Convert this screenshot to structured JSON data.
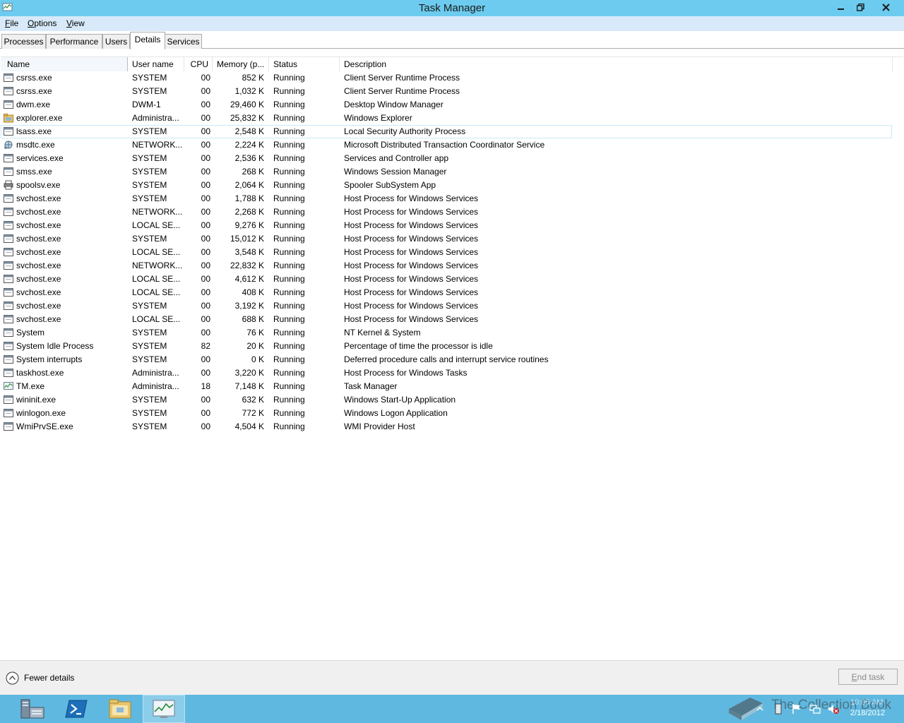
{
  "window": {
    "title": "Task Manager"
  },
  "menu": {
    "file": "File",
    "file_key": "F",
    "file_rest": "ile",
    "options_key": "O",
    "options_rest": "ptions",
    "view_key": "V",
    "view_rest": "iew"
  },
  "tabs": [
    {
      "label": "Processes"
    },
    {
      "label": "Performance"
    },
    {
      "label": "Users"
    },
    {
      "label": "Details",
      "active": true
    },
    {
      "label": "Services"
    }
  ],
  "columns": {
    "name": "Name",
    "user": "User name",
    "cpu": "CPU",
    "memory": "Memory (p...",
    "status": "Status",
    "description": "Description"
  },
  "processes": [
    {
      "name": "csrss.exe",
      "user": "SYSTEM",
      "cpu": "00",
      "memory": "852 K",
      "status": "Running",
      "description": "Client Server Runtime Process",
      "icon": "window-icon"
    },
    {
      "name": "csrss.exe",
      "user": "SYSTEM",
      "cpu": "00",
      "memory": "1,032 K",
      "status": "Running",
      "description": "Client Server Runtime Process",
      "icon": "window-icon"
    },
    {
      "name": "dwm.exe",
      "user": "DWM-1",
      "cpu": "00",
      "memory": "29,460 K",
      "status": "Running",
      "description": "Desktop Window Manager",
      "icon": "window-icon"
    },
    {
      "name": "explorer.exe",
      "user": "Administra...",
      "cpu": "00",
      "memory": "25,832 K",
      "status": "Running",
      "description": "Windows Explorer",
      "icon": "folder-icon"
    },
    {
      "name": "lsass.exe",
      "user": "SYSTEM",
      "cpu": "00",
      "memory": "2,548 K",
      "status": "Running",
      "description": "Local Security Authority Process",
      "icon": "window-icon"
    },
    {
      "name": "msdtc.exe",
      "user": "NETWORK...",
      "cpu": "00",
      "memory": "2,224 K",
      "status": "Running",
      "description": "Microsoft Distributed Transaction Coordinator Service",
      "icon": "network-icon"
    },
    {
      "name": "services.exe",
      "user": "SYSTEM",
      "cpu": "00",
      "memory": "2,536 K",
      "status": "Running",
      "description": "Services and Controller app",
      "icon": "window-icon"
    },
    {
      "name": "smss.exe",
      "user": "SYSTEM",
      "cpu": "00",
      "memory": "268 K",
      "status": "Running",
      "description": "Windows Session Manager",
      "icon": "window-icon"
    },
    {
      "name": "spoolsv.exe",
      "user": "SYSTEM",
      "cpu": "00",
      "memory": "2,064 K",
      "status": "Running",
      "description": "Spooler SubSystem App",
      "icon": "printer-icon"
    },
    {
      "name": "svchost.exe",
      "user": "SYSTEM",
      "cpu": "00",
      "memory": "1,788 K",
      "status": "Running",
      "description": "Host Process for Windows Services",
      "icon": "window-icon"
    },
    {
      "name": "svchost.exe",
      "user": "NETWORK...",
      "cpu": "00",
      "memory": "2,268 K",
      "status": "Running",
      "description": "Host Process for Windows Services",
      "icon": "window-icon"
    },
    {
      "name": "svchost.exe",
      "user": "LOCAL SE...",
      "cpu": "00",
      "memory": "9,276 K",
      "status": "Running",
      "description": "Host Process for Windows Services",
      "icon": "window-icon"
    },
    {
      "name": "svchost.exe",
      "user": "SYSTEM",
      "cpu": "00",
      "memory": "15,012 K",
      "status": "Running",
      "description": "Host Process for Windows Services",
      "icon": "window-icon"
    },
    {
      "name": "svchost.exe",
      "user": "LOCAL SE...",
      "cpu": "00",
      "memory": "3,548 K",
      "status": "Running",
      "description": "Host Process for Windows Services",
      "icon": "window-icon"
    },
    {
      "name": "svchost.exe",
      "user": "NETWORK...",
      "cpu": "00",
      "memory": "22,832 K",
      "status": "Running",
      "description": "Host Process for Windows Services",
      "icon": "window-icon"
    },
    {
      "name": "svchost.exe",
      "user": "LOCAL SE...",
      "cpu": "00",
      "memory": "4,612 K",
      "status": "Running",
      "description": "Host Process for Windows Services",
      "icon": "window-icon"
    },
    {
      "name": "svchost.exe",
      "user": "LOCAL SE...",
      "cpu": "00",
      "memory": "408 K",
      "status": "Running",
      "description": "Host Process for Windows Services",
      "icon": "window-icon"
    },
    {
      "name": "svchost.exe",
      "user": "SYSTEM",
      "cpu": "00",
      "memory": "3,192 K",
      "status": "Running",
      "description": "Host Process for Windows Services",
      "icon": "window-icon"
    },
    {
      "name": "svchost.exe",
      "user": "LOCAL SE...",
      "cpu": "00",
      "memory": "688 K",
      "status": "Running",
      "description": "Host Process for Windows Services",
      "icon": "window-icon"
    },
    {
      "name": "System",
      "user": "SYSTEM",
      "cpu": "00",
      "memory": "76 K",
      "status": "Running",
      "description": "NT Kernel & System",
      "icon": "window-icon"
    },
    {
      "name": "System Idle Process",
      "user": "SYSTEM",
      "cpu": "82",
      "memory": "20 K",
      "status": "Running",
      "description": "Percentage of time the processor is idle",
      "icon": "window-icon"
    },
    {
      "name": "System interrupts",
      "user": "SYSTEM",
      "cpu": "00",
      "memory": "0 K",
      "status": "Running",
      "description": "Deferred procedure calls and interrupt service routines",
      "icon": "window-icon"
    },
    {
      "name": "taskhost.exe",
      "user": "Administra...",
      "cpu": "00",
      "memory": "3,220 K",
      "status": "Running",
      "description": "Host Process for Windows Tasks",
      "icon": "window-icon"
    },
    {
      "name": "TM.exe",
      "user": "Administra...",
      "cpu": "18",
      "memory": "7,148 K",
      "status": "Running",
      "description": "Task Manager",
      "icon": "taskmanager-icon"
    },
    {
      "name": "wininit.exe",
      "user": "SYSTEM",
      "cpu": "00",
      "memory": "632 K",
      "status": "Running",
      "description": "Windows Start-Up Application",
      "icon": "window-icon"
    },
    {
      "name": "winlogon.exe",
      "user": "SYSTEM",
      "cpu": "00",
      "memory": "772 K",
      "status": "Running",
      "description": "Windows Logon Application",
      "icon": "window-icon"
    },
    {
      "name": "WmiPrvSE.exe",
      "user": "SYSTEM",
      "cpu": "00",
      "memory": "4,504 K",
      "status": "Running",
      "description": "WMI Provider Host",
      "icon": "window-icon"
    }
  ],
  "hover_row_index": 4,
  "footer": {
    "fewer_details": "Fewer details",
    "end_task_key": "E",
    "end_task_rest": "nd task"
  },
  "taskbar": {
    "watermark": "The Collection Book",
    "date": "2/18/2012",
    "time": "10:05 AM"
  },
  "colors": {
    "titlebar": "#6ccbee",
    "menubar": "#d8eaf9",
    "taskbar": "#5fb8e0"
  }
}
